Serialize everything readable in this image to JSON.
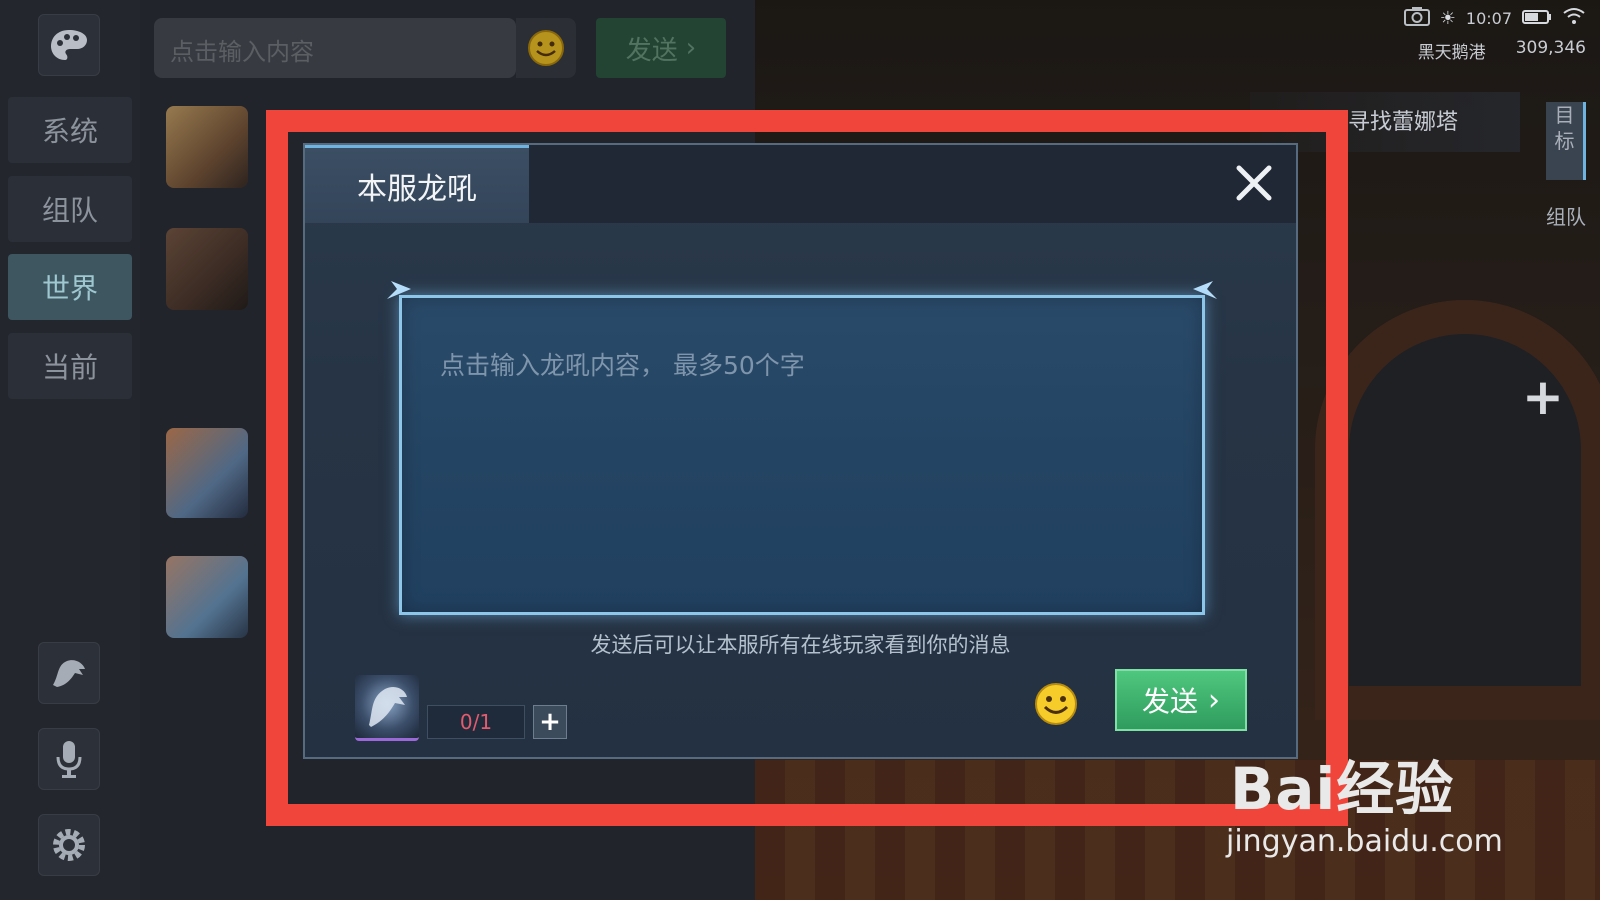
{
  "hud": {
    "time": "10:07",
    "location": "黑天鹅港",
    "coords": "309,346"
  },
  "quest": {
    "text": "寻找蕾娜塔"
  },
  "side_tabs": {
    "target": "目标",
    "team": "组队"
  },
  "rail": {
    "tabs": [
      {
        "label": "系统"
      },
      {
        "label": "组队"
      },
      {
        "label": "世界"
      },
      {
        "label": "当前"
      }
    ]
  },
  "chat": {
    "input_placeholder": "点击输入内容",
    "send_label": "发送"
  },
  "dialog": {
    "tab_title": "本服龙吼",
    "textarea_placeholder": "点击输入龙吼内容， 最多50个字",
    "hint": "发送后可以让本服所有在线玩家看到你的消息",
    "count": "0/1",
    "plus": "+",
    "send_label": "发送",
    "send_chevron": "›"
  },
  "watermark": {
    "brand": "Bai经验",
    "url": "jingyan.baidu.com"
  },
  "colors": {
    "highlight": "#f0453a",
    "send_green": "#3fb56e",
    "accent_blue": "#8ec6ea"
  }
}
